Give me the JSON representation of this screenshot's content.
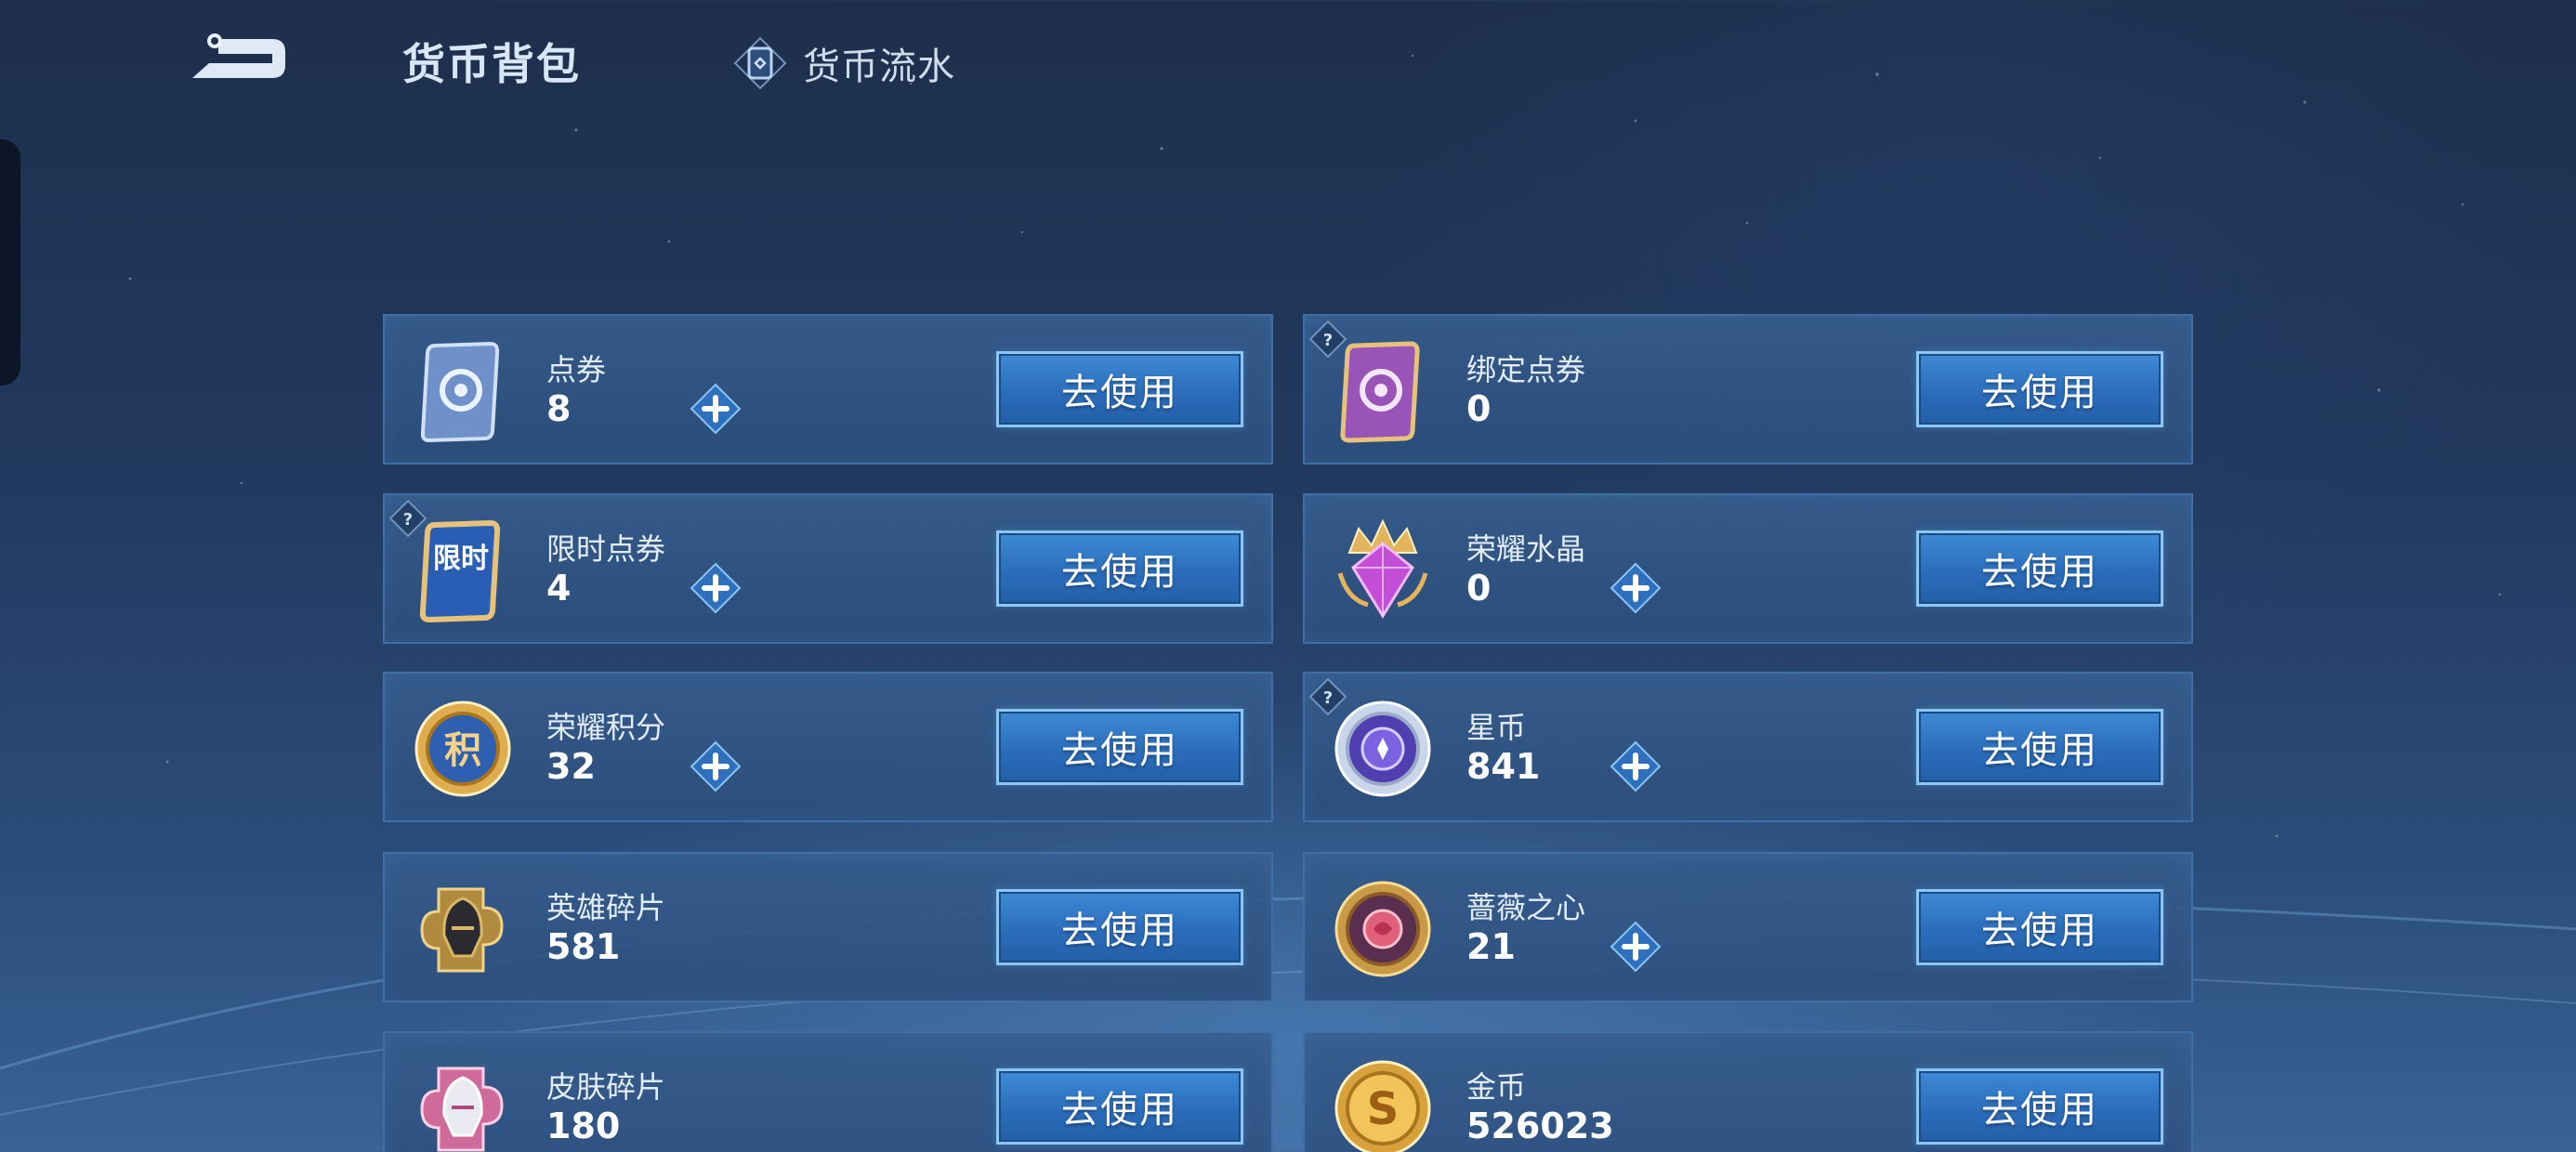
{
  "header": {
    "title": "货币背包",
    "flow_link": "货币流水",
    "back_icon": "back-arrow-icon"
  },
  "currencies": [
    {
      "name": "点券",
      "value": "8",
      "button": "去使用",
      "has_plus": true,
      "has_help": false,
      "icon": "ticket-blue-icon"
    },
    {
      "name": "绑定点券",
      "value": "0",
      "button": "去使用",
      "has_plus": false,
      "has_help": true,
      "icon": "ticket-purple-icon"
    },
    {
      "name": "限时点券",
      "value": "4",
      "button": "去使用",
      "has_plus": true,
      "has_help": true,
      "icon": "limited-ticket-icon",
      "icon_text": "限时"
    },
    {
      "name": "荣耀水晶",
      "value": "0",
      "button": "去使用",
      "has_plus": true,
      "has_help": false,
      "icon": "glory-crystal-icon"
    },
    {
      "name": "荣耀积分",
      "value": "32",
      "button": "去使用",
      "has_plus": true,
      "has_help": false,
      "icon": "glory-points-icon",
      "icon_text": "积"
    },
    {
      "name": "星币",
      "value": "841",
      "button": "去使用",
      "has_plus": true,
      "has_help": true,
      "icon": "star-coin-icon"
    },
    {
      "name": "英雄碎片",
      "value": "581",
      "button": "去使用",
      "has_plus": false,
      "has_help": false,
      "icon": "hero-fragment-icon"
    },
    {
      "name": "蔷薇之心",
      "value": "21",
      "button": "去使用",
      "has_plus": true,
      "has_help": false,
      "icon": "rose-heart-icon"
    },
    {
      "name": "皮肤碎片",
      "value": "180",
      "button": "去使用",
      "has_plus": false,
      "has_help": false,
      "icon": "skin-fragment-icon"
    },
    {
      "name": "金币",
      "value": "526023",
      "button": "去使用",
      "has_plus": false,
      "has_help": false,
      "icon": "gold-coin-icon",
      "icon_text": "S"
    }
  ],
  "colors": {
    "accent": "#2b6dbb",
    "button_border": "#8cc6f5",
    "card_border": "#3f6fa6"
  }
}
